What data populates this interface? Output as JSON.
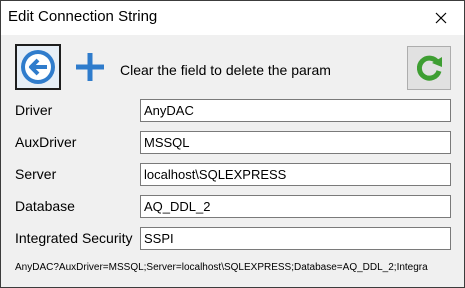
{
  "window": {
    "title": "Edit Connection String"
  },
  "toolbar": {
    "hint": "Clear the field to delete the param"
  },
  "params": [
    {
      "label": "Driver",
      "value": "AnyDAC"
    },
    {
      "label": "AuxDriver",
      "value": "MSSQL"
    },
    {
      "label": "Server",
      "value": "localhost\\SQLEXPRESS"
    },
    {
      "label": "Database",
      "value": "AQ_DDL_2"
    },
    {
      "label": "Integrated Security",
      "value": "SSPI"
    }
  ],
  "result": {
    "text": "AnyDAC?AuxDriver=MSSQL;Server=localhost\\SQLEXPRESS;Database=AQ_DDL_2;Integra"
  },
  "icons": {
    "back": "back-arrow-icon",
    "add": "plus-icon",
    "refresh": "refresh-icon",
    "close": "close-icon"
  },
  "colors": {
    "accent": "#2f7ccc",
    "refresh_green": "#3e9e32"
  }
}
